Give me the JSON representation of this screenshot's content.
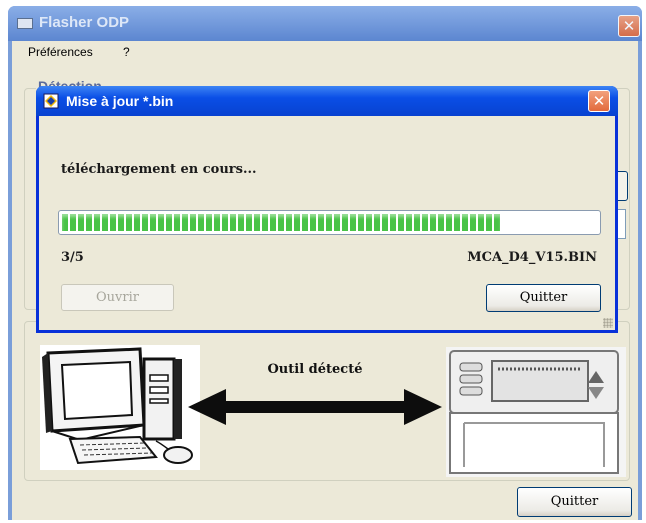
{
  "main_window": {
    "title": "Flasher ODP",
    "menu": [
      {
        "label": "Préférences"
      },
      {
        "label": "?"
      }
    ],
    "group_title": "Détection",
    "tool_status": "Outil détecté",
    "quit_label": "Quitter"
  },
  "dialog": {
    "title": "Mise à jour *.bin",
    "status": "téléchargement en cours...",
    "progress": {
      "current": 3,
      "total": 5,
      "label": "3/5",
      "fill_fraction": 0.82
    },
    "filename": "MCA_D4_V15.BIN",
    "open_label": "Ouvrir",
    "quit_label": "Quitter"
  },
  "colors": {
    "progress_green": "#49c347",
    "xp_blue": "#0842d0",
    "window_face": "#ece9d8",
    "close_red": "#e26a3c"
  },
  "icons": [
    "app-icon",
    "close-icon",
    "update-app-icon",
    "computer-icon",
    "double-arrow-icon",
    "device-icon",
    "resize-grip-icon"
  ]
}
